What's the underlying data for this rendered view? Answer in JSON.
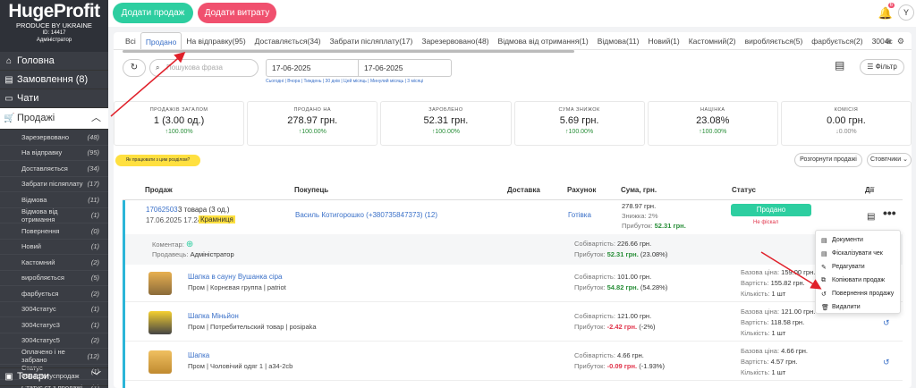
{
  "logo": {
    "brand": "HugeProfit",
    "sub": "PRODUCE BY UKRAINE",
    "id": "ID: 14417",
    "role": "Адміністратор"
  },
  "sidebar": {
    "main": [
      {
        "label": "Головна",
        "icon": "home-icon"
      },
      {
        "label": "Замовлення (8)",
        "icon": "file-icon"
      },
      {
        "label": "Чати",
        "icon": "chat-icon"
      }
    ],
    "active": {
      "label": "Продажі",
      "icon": "cart-icon"
    },
    "sub": [
      {
        "label": "Зарезервовано",
        "count": "(48)"
      },
      {
        "label": "На відправку",
        "count": "(95)"
      },
      {
        "label": "Доставляється",
        "count": "(34)"
      },
      {
        "label": "Забрати післяплату",
        "count": "(17)"
      },
      {
        "label": "Відмова",
        "count": "(11)"
      },
      {
        "label": "Відмова від отримання",
        "count": "(1)"
      },
      {
        "label": "Повернення",
        "count": "(0)"
      },
      {
        "label": "Новий",
        "count": "(1)"
      },
      {
        "label": "Кастомний",
        "count": "(2)"
      },
      {
        "label": "виробляється",
        "count": "(5)"
      },
      {
        "label": "фарбується",
        "count": "(2)"
      },
      {
        "label": "3004статус",
        "count": "(1)"
      },
      {
        "label": "3004статус3",
        "count": "(1)"
      },
      {
        "label": "3004статус5",
        "count": "(2)"
      },
      {
        "label": "Оплачено і не забрано",
        "count": "(12)"
      },
      {
        "label": "Статус 0504статуспродаж",
        "count": "(1)"
      },
      {
        "label": "Статус ст з продажі",
        "count": "(1)"
      }
    ],
    "bottom": {
      "label": "Товари",
      "icon": "box-icon"
    }
  },
  "topbar": {
    "add_sale": "Додати продаж",
    "add_expense": "Додати витрату",
    "notif_count": "6",
    "user_initial": "Y"
  },
  "tabs": [
    "Всі",
    "Продано",
    "На відправку(95)",
    "Доставляється(34)",
    "Забрати післяплату(17)",
    "Зарезервовано(48)",
    "Відмова від отримання(1)",
    "Відмова(11)",
    "Новий(1)",
    "Кастомний(2)",
    "виробляється(5)",
    "фарбується(2)",
    "3004с"
  ],
  "filters": {
    "search_placeholder": "Пошукова фраза",
    "date_from": "17-06-2025",
    "date_to": "17-06-2025",
    "shortcuts": "Сьогодні | Вчора | Тиждень | 30 днів | Цей місяць | Минулий місяць | 3 місяці",
    "filter_label": "Фільтр"
  },
  "stats": [
    {
      "label": "ПРОДАЖІВ ЗАГАЛОМ",
      "value": "1 (3.00 од.)",
      "pct": "↑100.00%"
    },
    {
      "label": "ПРОДАНО НА",
      "value": "278.97 грн.",
      "pct": "↑100.00%"
    },
    {
      "label": "ЗАРОБЛЕНО",
      "value": "52.31 грн.",
      "pct": "↑100.00%"
    },
    {
      "label": "СУМА ЗНИЖОК",
      "value": "5.69 грн.",
      "pct": "↑100.00%"
    },
    {
      "label": "НАЦІНКА",
      "value": "23.08%",
      "pct": "↑100.00%"
    },
    {
      "label": "КОМІСІЯ",
      "value": "0.00 грн.",
      "pct": "↓0.00%"
    }
  ],
  "help": "Як працювати з цим розділом?",
  "expand": "Розгорнути продажі",
  "columns_btn": "Стовпчики ⌄",
  "thead": {
    "sale": "Продаж",
    "buyer": "Покупець",
    "delivery": "Доставка",
    "account": "Рахунок",
    "sum": "Сума, грн.",
    "status": "Статус",
    "actions": "Дії"
  },
  "order": {
    "id": "17062503",
    "qty": "3 товара (3 од.)",
    "date": "17.06.2025 17.24",
    "tag": "Крамниця",
    "buyer": "Василь Котигорошко (+380735847373) (12)",
    "pay": "Готівка",
    "sum": "278.97 грн.",
    "discount": "Знижка: 2%",
    "profit_label": "Прибуток:",
    "profit": "52.31 грн.",
    "status": "Продано",
    "fiscal": "Не фіскал",
    "comment_label": "Коментар:",
    "seller_label": "Продавець:",
    "seller": "Адміністратор",
    "cost_label": "Собівартість:",
    "cost": "226.66 грн.",
    "profit2": "52.31 грн.",
    "profit_pct": "(23.08%)"
  },
  "items": [
    {
      "name": "Шапка в сауну Вушанка сіра",
      "cat": "Пром | Корнєвая группа | patriot",
      "cost": "101.00 грн.",
      "profit": "54.82 грн.",
      "pct": "(54.28%)",
      "base": "159.00 грн.",
      "price": "155.82 грн.",
      "qty": "1 шт",
      "neg": false
    },
    {
      "name": "Шапка Міньйон",
      "cat": "Пром | Потребительский товар | posipaka",
      "cost": "121.00 грн.",
      "profit": "-2.42 грн.",
      "pct": "(-2%)",
      "base": "121.00 грн.",
      "price": "118.58 грн.",
      "qty": "1 шт",
      "neg": true
    },
    {
      "name": "Шапка",
      "cat": "Пром | Чоловічий одяг 1 | a34-2cb",
      "cost": "4.66 грн.",
      "profit": "-0.09 грн.",
      "pct": "(-1.93%)",
      "base": "4.66 грн.",
      "price": "4.57 грн.",
      "qty": "1 шт",
      "neg": true
    }
  ],
  "item_labels": {
    "cost": "Собівартість:",
    "profit": "Прибуток:",
    "base": "Базова ціна:",
    "price": "Вартість:",
    "qty": "Кількість:"
  },
  "dropdown": [
    "Документи",
    "Фіскалізувати чек",
    "Редагувати",
    "Копіювати продаж",
    "Повернення продажу",
    "Видалити"
  ],
  "colors": {
    "accent_green": "#2dcea0",
    "accent_pink": "#f0506e",
    "sidebar": "#3a3d44",
    "link": "#3a70c8"
  }
}
